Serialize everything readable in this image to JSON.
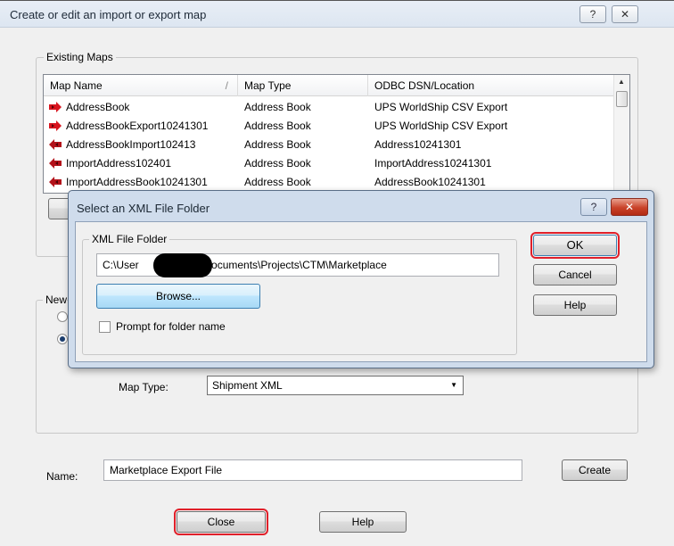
{
  "main_window": {
    "title": "Create or edit an import or export map",
    "help_btn": "?",
    "close_btn": "✕"
  },
  "existing_maps": {
    "legend": "Existing Maps",
    "columns": [
      "Map Name",
      "Map Type",
      "ODBC DSN/Location"
    ],
    "sort_indicator": "/",
    "rows": [
      {
        "name": "AddressBook",
        "type": "Address Book",
        "location": "UPS WorldShip CSV Export",
        "direction": "export"
      },
      {
        "name": "AddressBookExport10241301",
        "type": "Address Book",
        "location": "UPS WorldShip CSV Export",
        "direction": "export"
      },
      {
        "name": "AddressBookImport102413",
        "type": "Address Book",
        "location": "Address10241301",
        "direction": "import"
      },
      {
        "name": "ImportAddress102401",
        "type": "Address Book",
        "location": "ImportAddress10241301",
        "direction": "import"
      },
      {
        "name": "ImportAddressBook10241301",
        "type": "Address Book",
        "location": "AddressBook10241301",
        "direction": "import"
      }
    ]
  },
  "new_map": {
    "legend_fragment": "New",
    "map_type_label": "Map Type:",
    "map_type_value": "Shipment XML"
  },
  "name_row": {
    "label": "Name:",
    "value": "Marketplace Export File",
    "create_btn": "Create"
  },
  "bottom_buttons": {
    "close": "Close",
    "help": "Help"
  },
  "xml_dialog": {
    "title": "Select an XML File Folder",
    "help_btn": "?",
    "close_btn": "✕",
    "group_legend": "XML File Folder",
    "path_start": "C:\\User",
    "path_end": "Documents\\Projects\\CTM\\Marketplace",
    "browse_btn": "Browse...",
    "prompt_checkbox_label": "Prompt for folder name",
    "ok_btn": "OK",
    "cancel_btn": "Cancel",
    "help_side_btn": "Help"
  },
  "colors": {
    "highlight_outline": "#e0202a",
    "export_icon": "#d8141e",
    "import_icon": "#b3121a"
  }
}
